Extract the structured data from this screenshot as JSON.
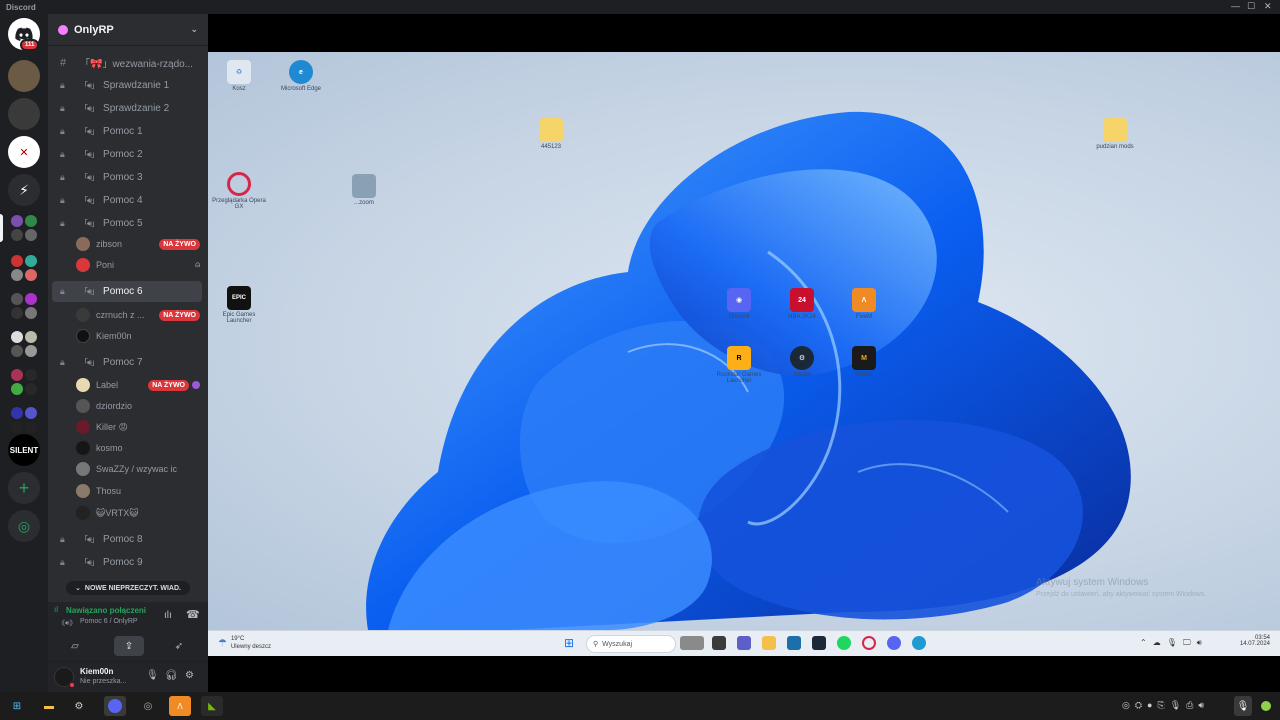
{
  "window": {
    "title": "Discord"
  },
  "server": {
    "name": "OnlyRP"
  },
  "guild_badge": "111",
  "guild_silent": "SILENT",
  "channels": [
    {
      "label": "「🎀」wezwania-rządo...",
      "type": "text"
    },
    {
      "label": "Sprawdzanie 1",
      "type": "voice"
    },
    {
      "label": "Sprawdzanie 2",
      "type": "voice"
    },
    {
      "label": "Pomoc 1",
      "type": "voice"
    },
    {
      "label": "Pomoc 2",
      "type": "voice"
    },
    {
      "label": "Pomoc 3",
      "type": "voice"
    },
    {
      "label": "Pomoc 4",
      "type": "voice"
    },
    {
      "label": "Pomoc 5",
      "type": "voice"
    }
  ],
  "pomoc5_users": [
    {
      "name": "zibson",
      "live": "NA ŻYWO"
    },
    {
      "name": "Poni",
      "live": ""
    }
  ],
  "active_channel": {
    "label": "Pomoc 6"
  },
  "pomoc6_users": [
    {
      "name": "czrnuch z ...",
      "live": "NA ŻYWO"
    },
    {
      "name": "Kiem00n",
      "live": ""
    }
  ],
  "channel7": {
    "label": "Pomoc 7"
  },
  "pomoc7_users": [
    {
      "name": "Label",
      "live": "NA ŻYWO"
    },
    {
      "name": "dziordzio",
      "live": ""
    },
    {
      "name": "Killer 😡",
      "live": ""
    },
    {
      "name": "kosmo",
      "live": ""
    },
    {
      "name": "SwaZZy / wzywac ic",
      "live": ""
    },
    {
      "name": "Thosu",
      "live": ""
    },
    {
      "name": "😺VRTX😺",
      "live": ""
    }
  ],
  "channels_after": [
    {
      "label": "Pomoc 8"
    },
    {
      "label": "Pomoc 9"
    }
  ],
  "new_unread": "NOWE NIEPRZECZYT. WIAD.",
  "voice": {
    "status": "Nawiązano połączeni",
    "channel": "Pomoc 6 / OnlyRP"
  },
  "user": {
    "name": "Kiem00n",
    "status": "Nie przeszka..."
  },
  "desktop": {
    "icons": [
      {
        "label": "Kosz"
      },
      {
        "label": "Microsoft Edge"
      },
      {
        "label": "445123"
      },
      {
        "label": "pudzian mods"
      },
      {
        "label": "Przeglądarka Opera GX"
      },
      {
        "label": "...zoom"
      },
      {
        "label": "Epic Games Launcher"
      },
      {
        "label": "Discord"
      },
      {
        "label": "NBA 2K24"
      },
      {
        "label": "FiveM"
      },
      {
        "label": "Rockstar Games Launcher"
      },
      {
        "label": "Steam"
      },
      {
        "label": "Medal"
      }
    ],
    "epic_text": "EPIC",
    "nba_text": "24",
    "watermark": "Aktywuj system Windows",
    "watermark_sub": "Przejdź do ustawień, aby aktywować system Windows."
  },
  "taskbar": {
    "temp": "19°C",
    "weather": "Ulewny deszcz",
    "search_placeholder": "Wyszukaj",
    "time": "03:54",
    "date": "14.07.2024"
  },
  "colors": {
    "accent": "#5865f2",
    "live": "#da373c",
    "connected": "#23a55a",
    "sidebar": "#2b2d31",
    "rail": "#1e1f22"
  }
}
